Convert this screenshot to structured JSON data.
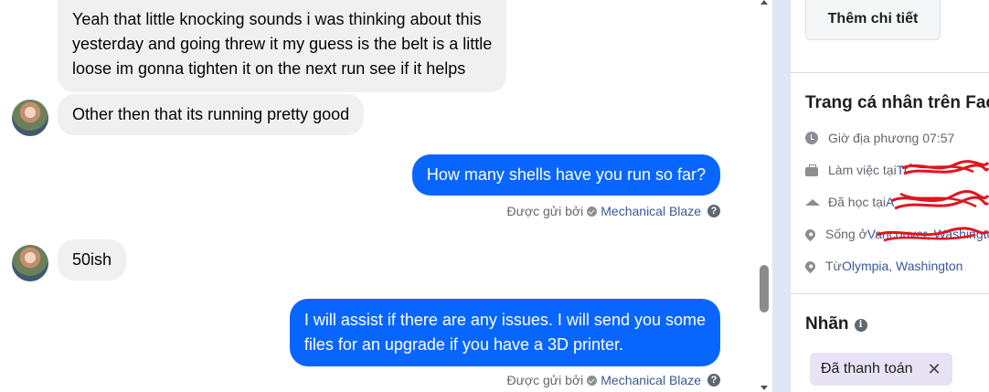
{
  "messages": [
    {
      "from": "them",
      "lines": [
        "Yeah that little knocking sounds i was thinking about this",
        "yesterday and going threw it my guess is the belt is a little",
        "loose im gonna tighten it on the next run see if it helps"
      ]
    },
    {
      "from": "them",
      "text": "Other then that its running pretty good"
    },
    {
      "from": "me",
      "text": "How many shells have you run so far?"
    },
    {
      "from": "them",
      "text": "50ish"
    },
    {
      "from": "me",
      "lines": [
        "I will assist if there are any issues. I will send you some",
        "files for an upgrade if you have a 3D printer."
      ]
    }
  ],
  "sent_by": {
    "prefix": "Được gửi bởi",
    "sender": "Mechanical Blaze",
    "icon": "check-circle-icon",
    "help_icon": "?"
  },
  "colors": {
    "outgoing_bubble": "#0866ff",
    "incoming_bubble": "#f0f0f0",
    "link": "#385898",
    "tag_bg": "#e7e3f4"
  },
  "panel": {
    "details_button": "Thêm chi tiết",
    "profile_title": "Trang cá nhân trên Facebook",
    "rows": [
      {
        "icon": "clock-icon",
        "prefix": "Giờ địa phương 07:57",
        "link": ""
      },
      {
        "icon": "briefcase-icon",
        "prefix": "Làm việc tại ",
        "link": "Tr"
      },
      {
        "icon": "graduation-cap-icon",
        "prefix": "Đã học tại ",
        "link": "A"
      },
      {
        "icon": "pin-icon",
        "prefix": "Sống ở ",
        "link": "Vancouver, Washington"
      },
      {
        "icon": "pin-icon",
        "prefix": "Từ ",
        "link": "Olympia, Washington"
      }
    ],
    "labels_title": "Nhãn",
    "labels_info_icon": "i",
    "tag": {
      "label": "Đã thanh toán",
      "remove": "✕"
    }
  }
}
